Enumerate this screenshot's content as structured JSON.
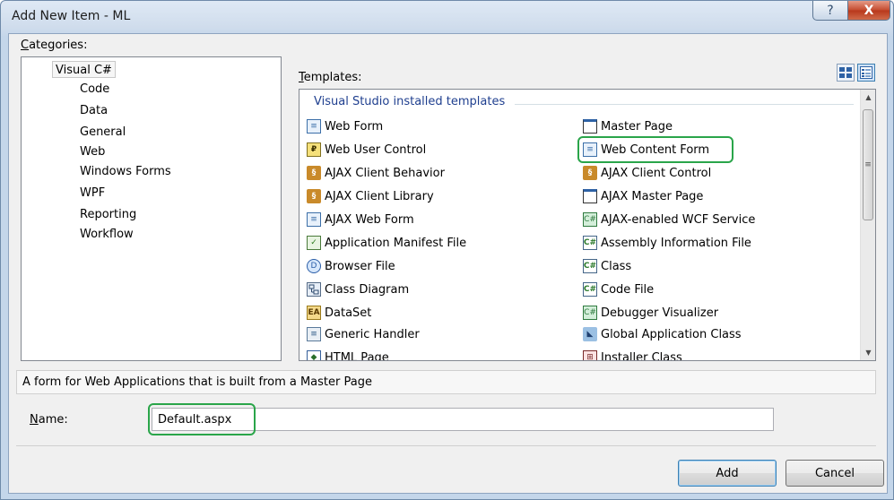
{
  "window": {
    "title": "Add New Item - ML",
    "help_glyph": "?",
    "close_glyph": "X"
  },
  "categories": {
    "label_mnemonic": "C",
    "label_rest": "ategories:",
    "root": "Visual C#",
    "items": [
      "Code",
      "Data",
      "General",
      "Web",
      "Windows Forms",
      "WPF",
      "Reporting",
      "Workflow"
    ]
  },
  "templates": {
    "label_mnemonic": "T",
    "label_rest": "emplates:",
    "group_title": "Visual Studio installed templates",
    "left_column": [
      {
        "label": "Web Form",
        "icon": "web-form-icon"
      },
      {
        "label": "Web User Control",
        "icon": "web-user-control-icon"
      },
      {
        "label": "AJAX Client Behavior",
        "icon": "ajax-client-behavior-icon"
      },
      {
        "label": "AJAX Client Library",
        "icon": "ajax-client-library-icon"
      },
      {
        "label": "AJAX Web Form",
        "icon": "ajax-web-form-icon"
      },
      {
        "label": "Application Manifest File",
        "icon": "manifest-file-icon"
      },
      {
        "label": "Browser File",
        "icon": "browser-file-icon"
      },
      {
        "label": "Class Diagram",
        "icon": "class-diagram-icon"
      },
      {
        "label": "DataSet",
        "icon": "dataset-icon"
      },
      {
        "label": "Generic Handler",
        "icon": "generic-handler-icon"
      },
      {
        "label": "HTML Page",
        "icon": "html-page-icon"
      }
    ],
    "right_column": [
      {
        "label": "Master Page",
        "icon": "master-page-icon"
      },
      {
        "label": "Web Content Form",
        "icon": "web-content-form-icon",
        "selected": true
      },
      {
        "label": "AJAX Client Control",
        "icon": "ajax-client-control-icon"
      },
      {
        "label": "AJAX Master Page",
        "icon": "ajax-master-page-icon"
      },
      {
        "label": "AJAX-enabled WCF Service",
        "icon": "wcf-service-icon"
      },
      {
        "label": "Assembly Information File",
        "icon": "assembly-info-icon"
      },
      {
        "label": "Class",
        "icon": "class-icon"
      },
      {
        "label": "Code File",
        "icon": "code-file-icon"
      },
      {
        "label": "Debugger Visualizer",
        "icon": "debugger-visualizer-icon"
      },
      {
        "label": "Global Application Class",
        "icon": "global-application-class-icon"
      },
      {
        "label": "Installer Class",
        "icon": "installer-class-icon"
      }
    ]
  },
  "description": "A form for Web Applications that is built from a Master Page",
  "name_field": {
    "label_mnemonic": "N",
    "label_rest": "ame:",
    "value": "Default.aspx"
  },
  "buttons": {
    "add": "Add",
    "cancel": "Cancel"
  },
  "colors": {
    "highlight_ring": "#2aa54a",
    "group_title": "#1f3f8f",
    "window_frame": "#c4d6ea"
  }
}
